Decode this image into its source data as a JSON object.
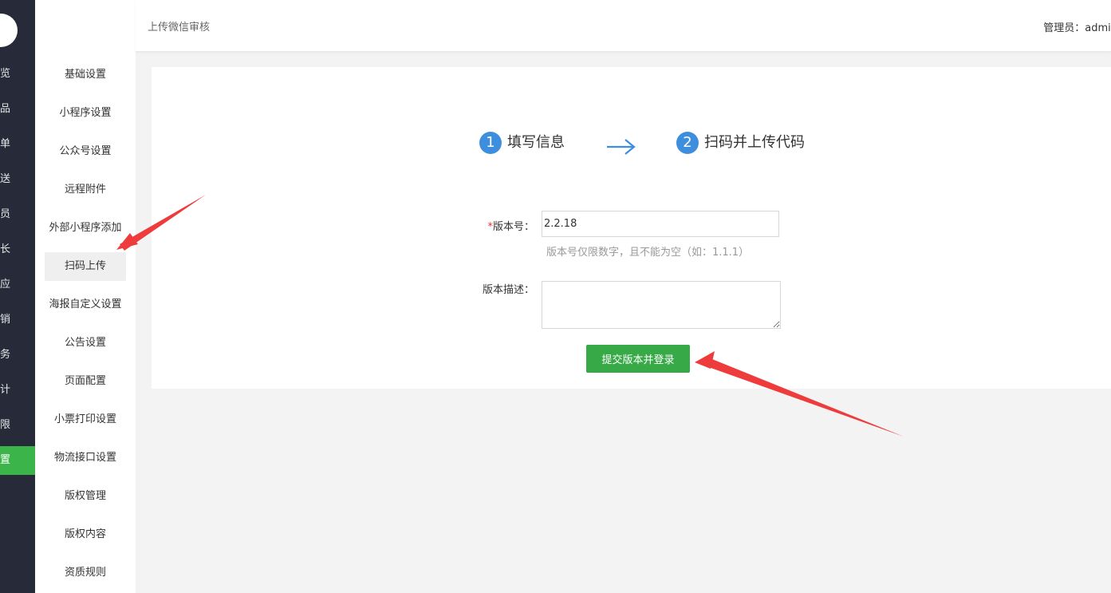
{
  "main_nav": {
    "items": [
      {
        "label": "总览"
      },
      {
        "label": "商品"
      },
      {
        "label": "订单"
      },
      {
        "label": "配送"
      },
      {
        "label": "会员"
      },
      {
        "label": "团长"
      },
      {
        "label": "供应"
      },
      {
        "label": "营销"
      },
      {
        "label": "财务"
      },
      {
        "label": "统计"
      },
      {
        "label": "权限"
      },
      {
        "label": "设置"
      }
    ],
    "active_index": 11
  },
  "sub_nav": {
    "items": [
      {
        "label": "基础设置"
      },
      {
        "label": "小程序设置"
      },
      {
        "label": "公众号设置"
      },
      {
        "label": "远程附件"
      },
      {
        "label": "外部小程序添加"
      },
      {
        "label": "扫码上传"
      },
      {
        "label": "海报自定义设置"
      },
      {
        "label": "公告设置"
      },
      {
        "label": "页面配置"
      },
      {
        "label": "小票打印设置"
      },
      {
        "label": "物流接口设置"
      },
      {
        "label": "版权管理"
      },
      {
        "label": "版权内容"
      },
      {
        "label": "资质规则"
      }
    ],
    "active_index": 5
  },
  "header": {
    "breadcrumb": "上传微信审核",
    "admin_label": "管理员：",
    "admin_name": "admin"
  },
  "steps": [
    {
      "number": "1",
      "label": "填写信息"
    },
    {
      "number": "2",
      "label": "扫码并上传代码"
    }
  ],
  "form": {
    "version_required_mark": "*",
    "version_label": "版本号：",
    "version_value": "2.2.18",
    "version_hint": "版本号仅限数字，且不能为空（如：1.1.1）",
    "desc_label": "版本描述：",
    "desc_value": "",
    "submit_label": "提交版本并登录"
  },
  "colors": {
    "accent_green": "#3bb44a",
    "step_blue": "#3e8ede",
    "annotation_red": "#ee3b3b",
    "nav_dark": "#272b39"
  }
}
